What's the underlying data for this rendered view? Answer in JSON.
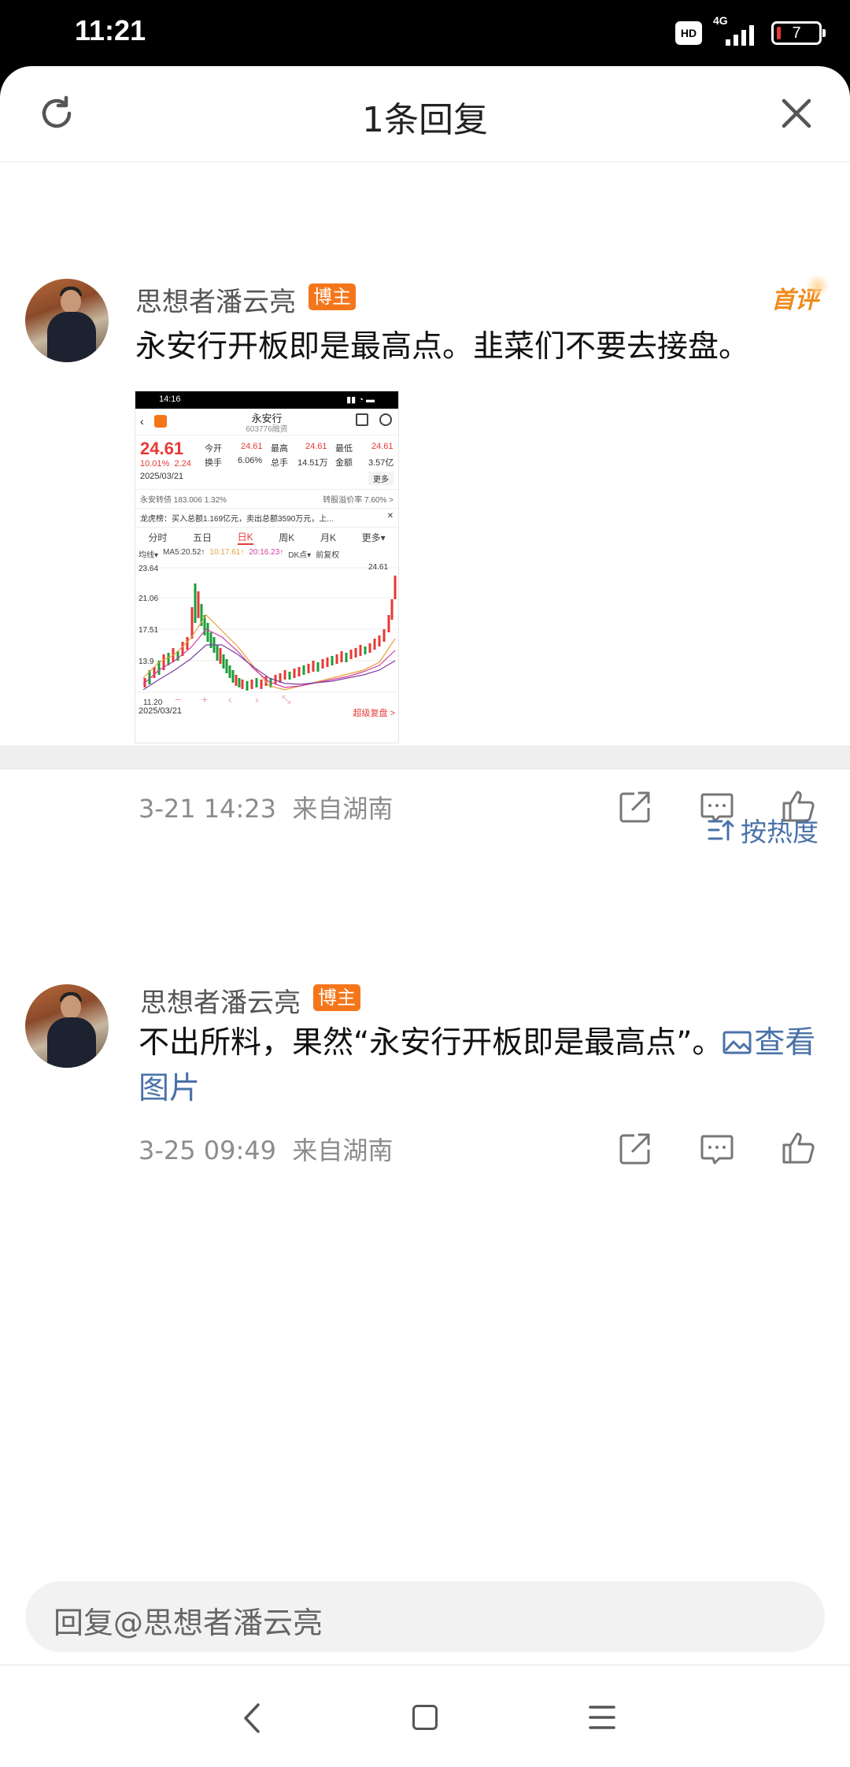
{
  "status": {
    "time": "11:21",
    "hd": "HD",
    "network": "4G",
    "battery": "7"
  },
  "header": {
    "title": "1条回复"
  },
  "main_comment": {
    "username": "思想者潘云亮",
    "badge": "博主",
    "first_comment_label": "首评",
    "text": "永安行开板即是最高点。韭菜们不要去接盘。",
    "timestamp": "3-21 14:23",
    "location": "来自湖南",
    "image": {
      "status_time": "14:16",
      "stock_name": "永安行",
      "stock_code": "603776融资",
      "price": "24.61",
      "change_pct": "10.01%",
      "change_abs": "2.24",
      "date": "2025/03/21",
      "open_label": "今开",
      "open": "24.61",
      "high_label": "最高",
      "high": "24.61",
      "low_label": "最低",
      "low": "24.61",
      "turnover_label": "换手",
      "turnover": "6.06%",
      "volume_label": "总手",
      "volume": "14.51万",
      "amount_label": "金额",
      "amount": "3.57亿",
      "more_label": "更多",
      "bond_row": "永安转债  183.006  1.32%",
      "bond_premium": "转股溢价率  7.60% >",
      "dragon_row": "龙虎榜：买入总额1.169亿元，卖出总额3590万元，上...",
      "tabs": [
        "分时",
        "五日",
        "日K",
        "周K",
        "月K",
        "更多▾"
      ],
      "active_tab": "日K",
      "ma_line": [
        "均线▾",
        "MA5:20.52↑",
        "10:17.61↑",
        "20:16.23↑",
        "DK点▾",
        "前复权"
      ],
      "y_top": "23.64",
      "y_mid1": "21.06",
      "y_mid2": "17.51",
      "y_mid3": "13.9",
      "y_bottom": "11.20",
      "latest_mark": "24.61",
      "footer_date": "2025/03/21",
      "footer_link": "超级复盘 >",
      "chart_controls": [
        "−",
        "+",
        "‹",
        "›",
        "⤡"
      ]
    }
  },
  "sort_label": "按热度",
  "reply": {
    "username": "思想者潘云亮",
    "badge": "博主",
    "text_part1": "不出所料，果然“永安行开板即是最高点”。",
    "link_text": "查看图片",
    "timestamp": "3-25 09:49",
    "location": "来自湖南"
  },
  "reply_input": {
    "placeholder": "回复@思想者潘云亮"
  },
  "colors": {
    "accent_orange": "#f5761a",
    "link_blue": "#4a72a8",
    "up_red": "#e53935",
    "down_green": "#1a9e3a"
  }
}
